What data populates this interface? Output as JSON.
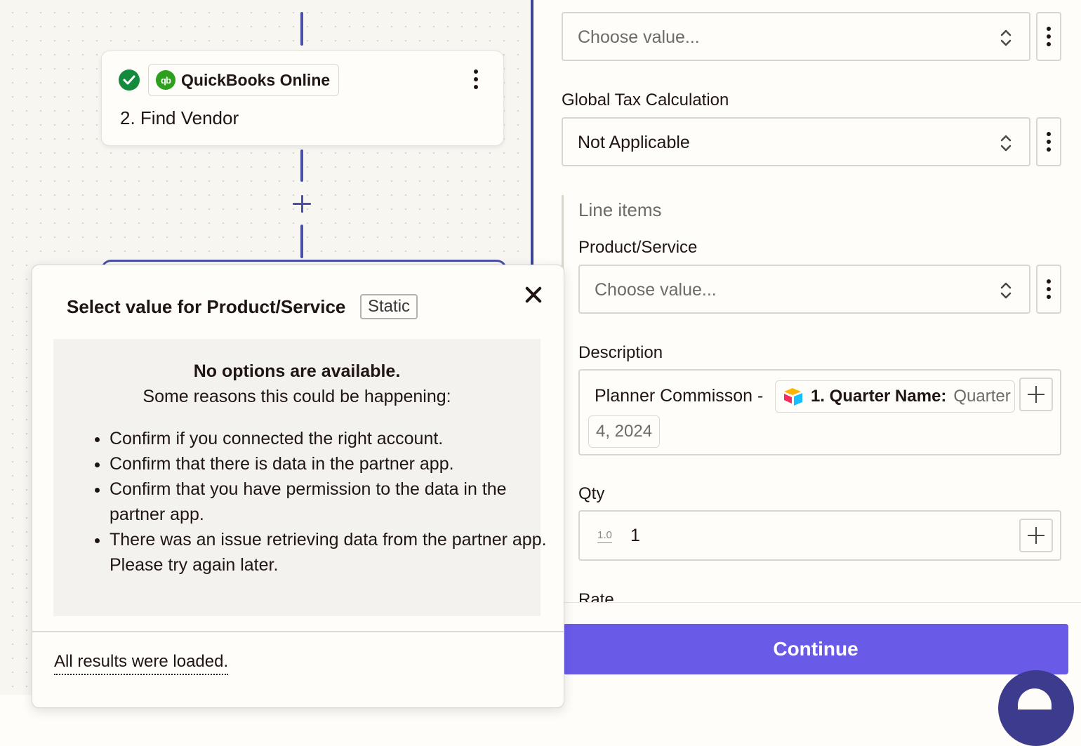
{
  "canvas": {
    "step": {
      "app_name": "QuickBooks Online",
      "title": "2. Find Vendor",
      "status": "success",
      "icons": [
        "check-circle-icon",
        "quickbooks-logo",
        "kebab-menu-icon"
      ]
    }
  },
  "popup": {
    "title": "Select value for Product/Service",
    "badge": "Static",
    "message_title": "No options are available.",
    "message_subtitle": "Some reasons this could be happening:",
    "reasons": [
      "Confirm if you connected the right account.",
      "Confirm that there is data in the partner app.",
      "Confirm that you have permission to the data in the partner app.",
      "There was an issue retrieving data from the partner app. Please try again later."
    ],
    "footer": "All results were loaded."
  },
  "form": {
    "department": {
      "placeholder": "Choose value..."
    },
    "global_tax": {
      "label": "Global Tax Calculation",
      "value": "Not Applicable"
    },
    "line_items": {
      "title": "Line items",
      "product_service": {
        "label": "Product/Service",
        "placeholder": "Choose value..."
      },
      "description": {
        "label": "Description",
        "text": "Planner Commisson -",
        "pill_key": "1. Quarter Name:",
        "pill_value": "Quarter",
        "pill_value_cont": "4, 2024"
      },
      "qty": {
        "label": "Qty",
        "type_hint": "1.0",
        "value": "1"
      },
      "rate": {
        "label": "Rate"
      }
    },
    "continue_label": "Continue"
  },
  "colors": {
    "accent": "#695be8",
    "connector": "#4a4fa8",
    "success": "#138a3c",
    "quickbooks": "#2ca01c"
  }
}
